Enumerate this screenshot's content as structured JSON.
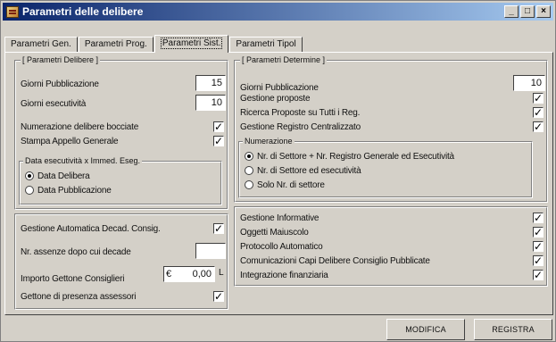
{
  "window": {
    "title": "Parametri delle delibere",
    "buttons": [
      "_",
      "□",
      "×"
    ]
  },
  "tabs": [
    {
      "label": "Parametri Gen."
    },
    {
      "label": "Parametri Prog."
    },
    {
      "label": "Parametri Sist."
    },
    {
      "label": "Parametri Tipol"
    }
  ],
  "active_tab": 2,
  "delibere": {
    "legend": "[ Parametri Delibere ]",
    "giorni_pubblicazione_label": "Giorni Pubblicazione",
    "giorni_pubblicazione_value": "15",
    "giorni_esecutivita_label": "Giorni esecutività",
    "giorni_esecutivita_value": "10",
    "numerazione_bocciate_label": "Numerazione delibere bocciate",
    "numerazione_bocciate_checked": true,
    "stampa_appello_label": "Stampa Appello Generale",
    "stampa_appello_checked": true,
    "data_esecutivita": {
      "legend": "Data esecutività x Immed. Eseg.",
      "options": [
        "Data Delibera",
        "Data Pubblicazione"
      ],
      "selected": 0
    }
  },
  "decadenze": {
    "gestione_decad_label": "Gestione Automatica Decad. Consig.",
    "gestione_decad_checked": true,
    "nr_assenze_label": "Nr. assenze dopo cui decade",
    "nr_assenze_value": "",
    "importo_gettone_label": "Importo Gettone Consiglieri",
    "importo_gettone_currency": "€",
    "importo_gettone_value": "0,00",
    "importo_gettone_suffix": "L",
    "gettone_assessori_label": "Gettone di presenza assessori",
    "gettone_assessori_checked": true
  },
  "determine": {
    "legend": "[ Parametri Determine ]",
    "giorni_pubblicazione_label": "Giorni Pubblicazione",
    "giorni_pubblicazione_value": "10",
    "gestione_proposte_label": "Gestione proposte",
    "gestione_proposte_checked": true,
    "ricerca_proposte_label": "Ricerca Proposte su Tutti i Reg.",
    "ricerca_proposte_checked": true,
    "gestione_registro_label": "Gestione Registro Centralizzato",
    "gestione_registro_checked": true,
    "numerazione": {
      "legend": "Numerazione",
      "options": [
        "Nr. di Settore + Nr. Registro Generale ed Esecutività",
        "Nr. di Settore ed esecutività",
        "Solo Nr. di settore"
      ],
      "selected": 0
    }
  },
  "opzioni": [
    {
      "label": "Gestione Informative",
      "checked": true
    },
    {
      "label": "Oggetti Maiuscolo",
      "checked": true
    },
    {
      "label": "Protocollo Automatico",
      "checked": true
    },
    {
      "label": "Comunicazioni Capi Delibere Consiglio Pubblicate",
      "checked": true
    },
    {
      "label": "Integrazione finanziaria",
      "checked": true
    }
  ],
  "footer": {
    "modifica_label": "MODIFICA",
    "registra_label": "REGISTRA"
  }
}
